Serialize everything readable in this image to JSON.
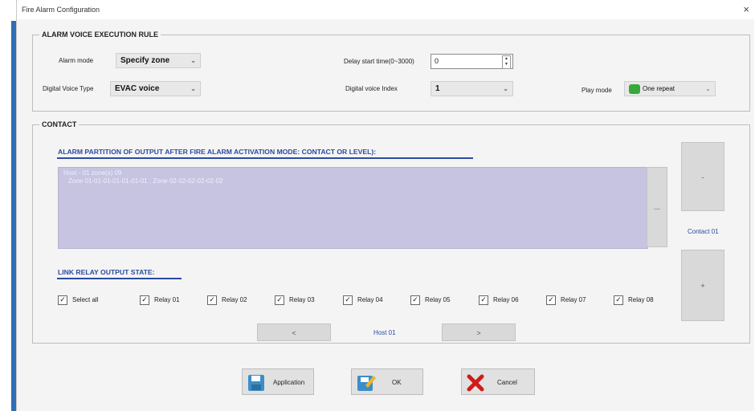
{
  "window": {
    "title": "Fire Alarm Configuration",
    "close_glyph": "×"
  },
  "alarm_group": {
    "legend": "ALARM VOICE EXECUTION RULE",
    "alarm_mode": {
      "label": "Alarm mode",
      "value": "Specify zone"
    },
    "delay": {
      "label": "Delay start time(0~3000)",
      "value": "0"
    },
    "voice_type": {
      "label": "Digital Voice Type",
      "value": "EVAC voice"
    },
    "voice_index": {
      "label": "Digital voice Index",
      "value": "1"
    },
    "play_mode": {
      "label": "Play mode",
      "value": "One repeat"
    }
  },
  "contact_group": {
    "legend": "CONTACT",
    "partition_title": "ALARM PARTITION OF OUTPUT AFTER FIRE ALARM ACTIVATION MODE: CONTACT OR LEVEL):",
    "partition_list": {
      "header": "Host - 01 zone(s) 09",
      "sub": "Zone 01-01-01-01-01-01-01 ; Zone 02-02-02-02-02-02"
    },
    "ellipsis_button": "...",
    "contact_up": "-",
    "contact_label": "Contact 01",
    "contact_down": "+",
    "relay_title": "LINK RELAY OUTPUT STATE:",
    "select_all": "Select all",
    "relays": [
      "Relay 01",
      "Relay 02",
      "Relay 03",
      "Relay 04",
      "Relay 05",
      "Relay 06",
      "Relay 07",
      "Relay 08"
    ],
    "prev_button": "<",
    "host_label": "Host 01",
    "next_button": ">"
  },
  "footer": {
    "apply": "Application",
    "ok": "OK",
    "cancel": "Cancel"
  },
  "colors": {
    "accent_blue": "#2b4aa0",
    "list_bg": "#c6c4e0",
    "window_bg": "#f4f4f4"
  }
}
